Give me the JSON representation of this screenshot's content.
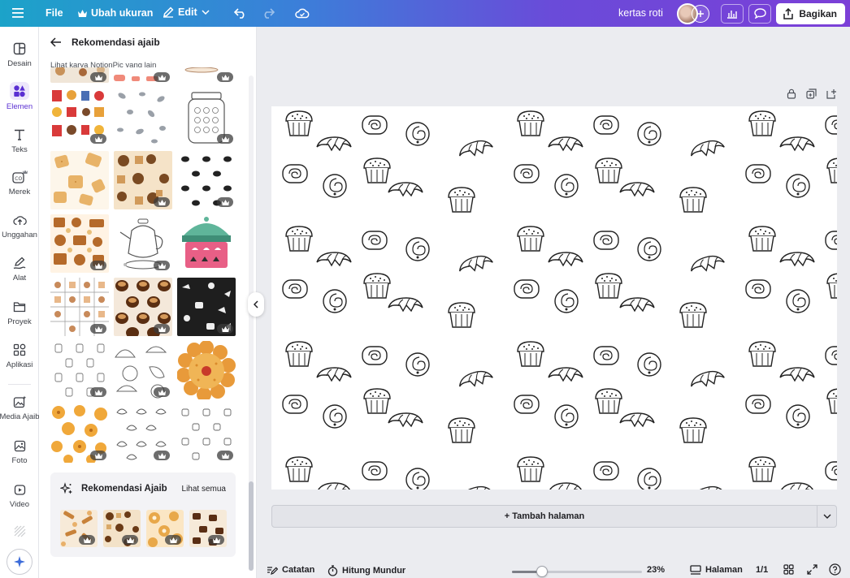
{
  "topbar": {
    "file_label": "File",
    "resize_label": "Ubah ukuran",
    "edit_label": "Edit",
    "doc_title": "kertas roti",
    "share_label": "Bagikan"
  },
  "rail": {
    "items": [
      {
        "label": "Desain",
        "icon": "layout-icon"
      },
      {
        "label": "Elemen",
        "icon": "shapes-icon"
      },
      {
        "label": "Teks",
        "icon": "text-icon"
      },
      {
        "label": "Merek",
        "icon": "brand-icon"
      },
      {
        "label": "Unggahan",
        "icon": "upload-icon"
      },
      {
        "label": "Alat",
        "icon": "draw-icon"
      },
      {
        "label": "Proyek",
        "icon": "folder-icon"
      },
      {
        "label": "Aplikasi",
        "icon": "apps-icon"
      },
      {
        "label": "Media Ajaib",
        "icon": "magic-media-icon"
      },
      {
        "label": "Foto",
        "icon": "photo-icon"
      },
      {
        "label": "Video",
        "icon": "video-icon"
      }
    ]
  },
  "panel": {
    "title": "Rekomendasi ajaib",
    "subtitle": "Lihat karya NotionPic yang lain",
    "recommend_title": "Rekomendasi Ajaib",
    "see_all": "Lihat semua"
  },
  "canvas": {
    "add_page_label": "+ Tambah halaman"
  },
  "bottombar": {
    "notes_label": "Catatan",
    "timer_label": "Hitung Mundur",
    "zoom": "23%",
    "zoom_fraction": 0.23,
    "pages_label": "Halaman",
    "page_count": "1/1"
  },
  "colors": {
    "accent": "#7b3fd7",
    "topbar_start": "#1ca3c9",
    "topbar_end": "#7b3fd7"
  }
}
